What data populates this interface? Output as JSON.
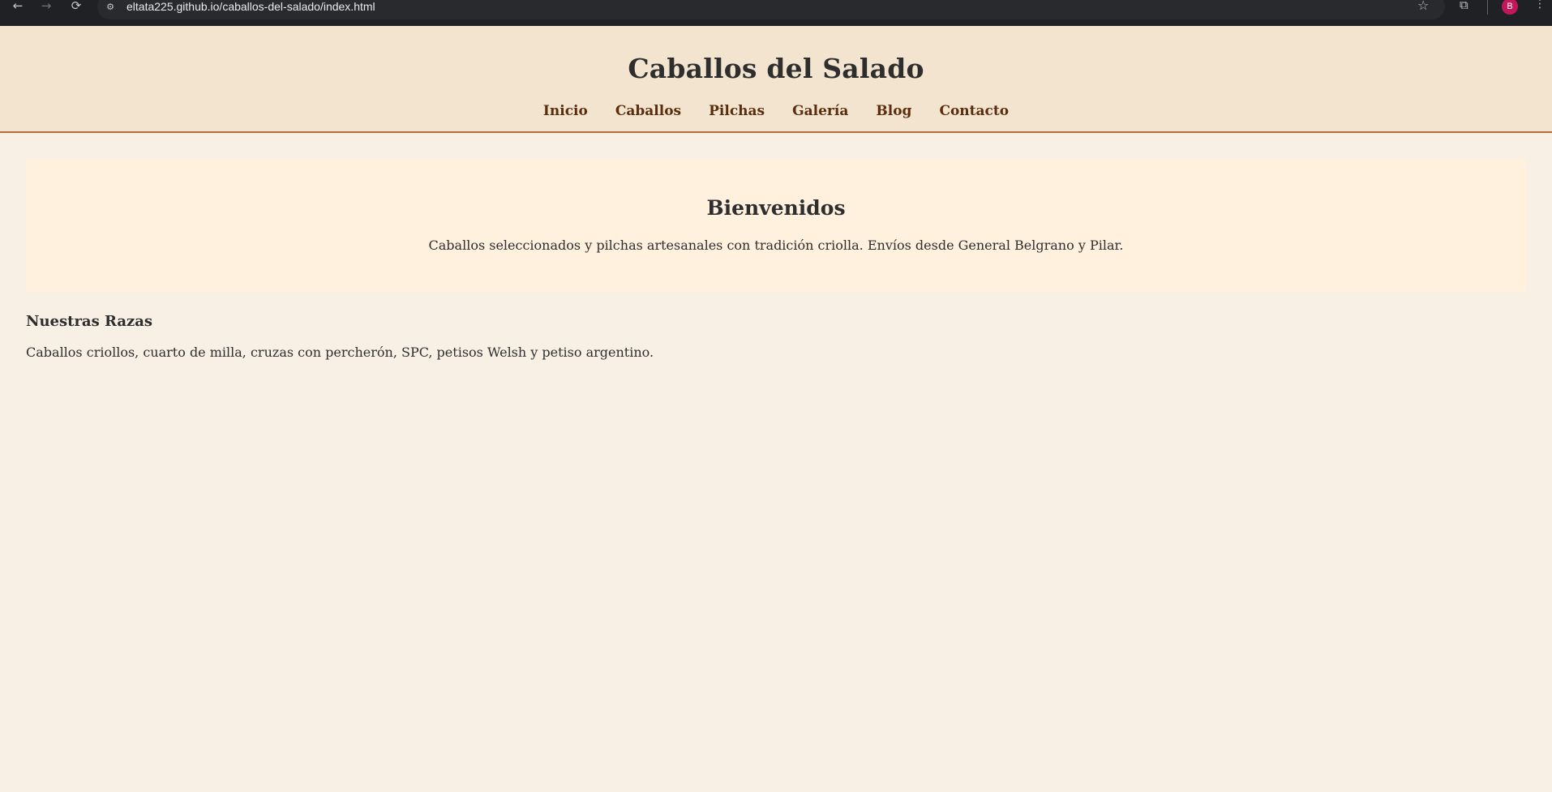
{
  "browser": {
    "back_icon": "←",
    "forward_icon": "→",
    "reload_icon": "⟳",
    "site_info_icon": "⚙",
    "url": "eltata225.github.io/caballos-del-salado/index.html",
    "star_icon": "☆",
    "extensions_icon": "⧉",
    "avatar_letter": "B",
    "menu_icon": "⋮"
  },
  "header": {
    "title": "Caballos del Salado",
    "nav": [
      "Inicio",
      "Caballos",
      "Pilchas",
      "Galería",
      "Blog",
      "Contacto"
    ]
  },
  "hero": {
    "heading": "Bienvenidos",
    "text": "Caballos seleccionados y pilchas artesanales con tradición criolla. Envíos desde General Belgrano y Pilar."
  },
  "razas": {
    "heading": "Nuestras Razas",
    "text": "Caballos criollos, cuarto de milla, cruzas con percherón, SPC, petisos Welsh y petiso argentino."
  },
  "colors": {
    "header_bg": "#f2e4cf",
    "header_border": "#b56f3e",
    "nav_link": "#5a2d0c",
    "page_bg": "#f8efe5",
    "hero_bg": "#fff1de",
    "avatar_bg": "#c2185b"
  }
}
